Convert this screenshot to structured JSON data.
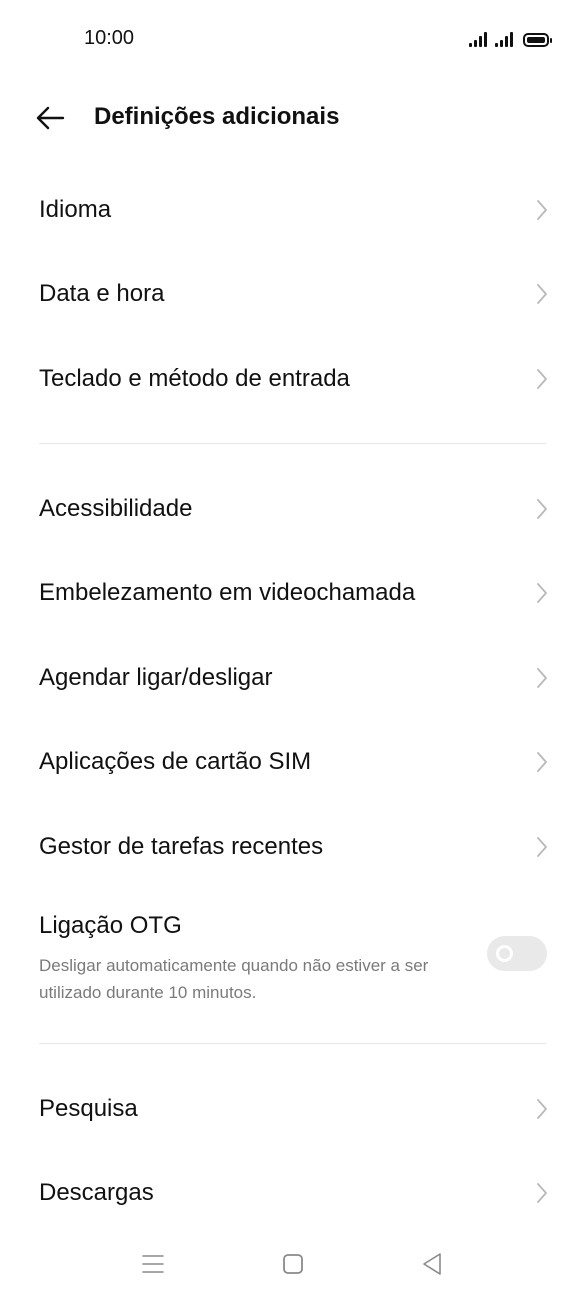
{
  "status_bar": {
    "time": "10:00",
    "icons": [
      "signal-1-icon",
      "signal-2-icon",
      "battery-icon"
    ]
  },
  "header": {
    "back_icon": "arrow-left-icon",
    "title": "Definições adicionais"
  },
  "items": [
    {
      "label": "Idioma"
    },
    {
      "label": "Data e hora"
    },
    {
      "label": "Teclado e método de entrada"
    },
    {
      "label": "Acessibilidade"
    },
    {
      "label": "Embelezamento em videochamada"
    },
    {
      "label": "Agendar ligar/desligar"
    },
    {
      "label": "Aplicações de cartão SIM"
    },
    {
      "label": "Gestor de tarefas recentes"
    },
    {
      "label": "Pesquisa"
    },
    {
      "label": "Descargas"
    }
  ],
  "otg": {
    "title": "Ligação OTG",
    "description": "Desligar automaticamente quando não estiver a ser utilizado durante 10 minutos.",
    "enabled": false
  },
  "nav_bar": {
    "icons": [
      "menu-icon",
      "home-icon",
      "back-triangle-icon"
    ]
  },
  "colors": {
    "text": "#111111",
    "secondary_text": "#7a7a7a",
    "chevron": "#b9b9b9",
    "divider": "#e6e6e6",
    "toggle_off_track": "#e9e9e9",
    "nav_icon": "#8a8a8a"
  }
}
